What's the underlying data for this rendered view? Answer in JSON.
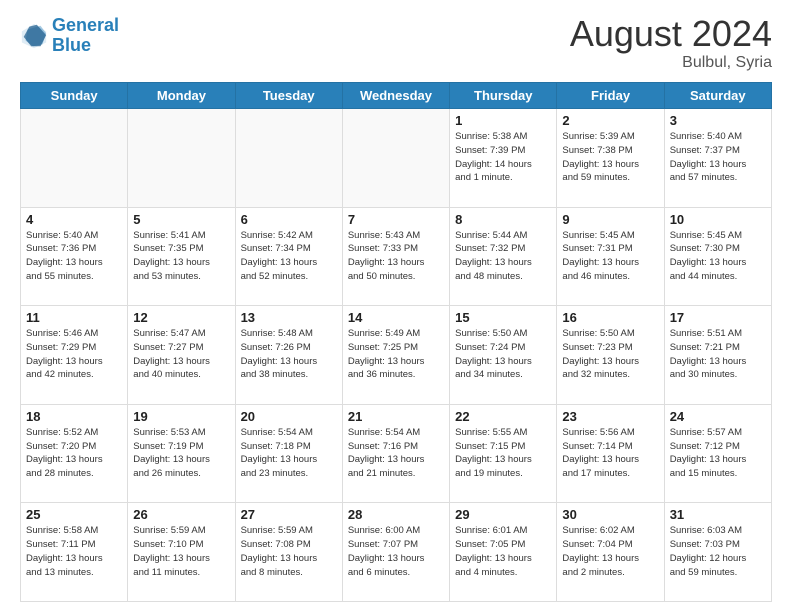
{
  "header": {
    "logo_line1": "General",
    "logo_line2": "Blue",
    "month_year": "August 2024",
    "location": "Bulbul, Syria"
  },
  "days_of_week": [
    "Sunday",
    "Monday",
    "Tuesday",
    "Wednesday",
    "Thursday",
    "Friday",
    "Saturday"
  ],
  "weeks": [
    [
      {
        "day": "",
        "info": "",
        "empty": true
      },
      {
        "day": "",
        "info": "",
        "empty": true
      },
      {
        "day": "",
        "info": "",
        "empty": true
      },
      {
        "day": "",
        "info": "",
        "empty": true
      },
      {
        "day": "1",
        "info": "Sunrise: 5:38 AM\nSunset: 7:39 PM\nDaylight: 14 hours\nand 1 minute."
      },
      {
        "day": "2",
        "info": "Sunrise: 5:39 AM\nSunset: 7:38 PM\nDaylight: 13 hours\nand 59 minutes."
      },
      {
        "day": "3",
        "info": "Sunrise: 5:40 AM\nSunset: 7:37 PM\nDaylight: 13 hours\nand 57 minutes."
      }
    ],
    [
      {
        "day": "4",
        "info": "Sunrise: 5:40 AM\nSunset: 7:36 PM\nDaylight: 13 hours\nand 55 minutes."
      },
      {
        "day": "5",
        "info": "Sunrise: 5:41 AM\nSunset: 7:35 PM\nDaylight: 13 hours\nand 53 minutes."
      },
      {
        "day": "6",
        "info": "Sunrise: 5:42 AM\nSunset: 7:34 PM\nDaylight: 13 hours\nand 52 minutes."
      },
      {
        "day": "7",
        "info": "Sunrise: 5:43 AM\nSunset: 7:33 PM\nDaylight: 13 hours\nand 50 minutes."
      },
      {
        "day": "8",
        "info": "Sunrise: 5:44 AM\nSunset: 7:32 PM\nDaylight: 13 hours\nand 48 minutes."
      },
      {
        "day": "9",
        "info": "Sunrise: 5:45 AM\nSunset: 7:31 PM\nDaylight: 13 hours\nand 46 minutes."
      },
      {
        "day": "10",
        "info": "Sunrise: 5:45 AM\nSunset: 7:30 PM\nDaylight: 13 hours\nand 44 minutes."
      }
    ],
    [
      {
        "day": "11",
        "info": "Sunrise: 5:46 AM\nSunset: 7:29 PM\nDaylight: 13 hours\nand 42 minutes."
      },
      {
        "day": "12",
        "info": "Sunrise: 5:47 AM\nSunset: 7:27 PM\nDaylight: 13 hours\nand 40 minutes."
      },
      {
        "day": "13",
        "info": "Sunrise: 5:48 AM\nSunset: 7:26 PM\nDaylight: 13 hours\nand 38 minutes."
      },
      {
        "day": "14",
        "info": "Sunrise: 5:49 AM\nSunset: 7:25 PM\nDaylight: 13 hours\nand 36 minutes."
      },
      {
        "day": "15",
        "info": "Sunrise: 5:50 AM\nSunset: 7:24 PM\nDaylight: 13 hours\nand 34 minutes."
      },
      {
        "day": "16",
        "info": "Sunrise: 5:50 AM\nSunset: 7:23 PM\nDaylight: 13 hours\nand 32 minutes."
      },
      {
        "day": "17",
        "info": "Sunrise: 5:51 AM\nSunset: 7:21 PM\nDaylight: 13 hours\nand 30 minutes."
      }
    ],
    [
      {
        "day": "18",
        "info": "Sunrise: 5:52 AM\nSunset: 7:20 PM\nDaylight: 13 hours\nand 28 minutes."
      },
      {
        "day": "19",
        "info": "Sunrise: 5:53 AM\nSunset: 7:19 PM\nDaylight: 13 hours\nand 26 minutes."
      },
      {
        "day": "20",
        "info": "Sunrise: 5:54 AM\nSunset: 7:18 PM\nDaylight: 13 hours\nand 23 minutes."
      },
      {
        "day": "21",
        "info": "Sunrise: 5:54 AM\nSunset: 7:16 PM\nDaylight: 13 hours\nand 21 minutes."
      },
      {
        "day": "22",
        "info": "Sunrise: 5:55 AM\nSunset: 7:15 PM\nDaylight: 13 hours\nand 19 minutes."
      },
      {
        "day": "23",
        "info": "Sunrise: 5:56 AM\nSunset: 7:14 PM\nDaylight: 13 hours\nand 17 minutes."
      },
      {
        "day": "24",
        "info": "Sunrise: 5:57 AM\nSunset: 7:12 PM\nDaylight: 13 hours\nand 15 minutes."
      }
    ],
    [
      {
        "day": "25",
        "info": "Sunrise: 5:58 AM\nSunset: 7:11 PM\nDaylight: 13 hours\nand 13 minutes."
      },
      {
        "day": "26",
        "info": "Sunrise: 5:59 AM\nSunset: 7:10 PM\nDaylight: 13 hours\nand 11 minutes."
      },
      {
        "day": "27",
        "info": "Sunrise: 5:59 AM\nSunset: 7:08 PM\nDaylight: 13 hours\nand 8 minutes."
      },
      {
        "day": "28",
        "info": "Sunrise: 6:00 AM\nSunset: 7:07 PM\nDaylight: 13 hours\nand 6 minutes."
      },
      {
        "day": "29",
        "info": "Sunrise: 6:01 AM\nSunset: 7:05 PM\nDaylight: 13 hours\nand 4 minutes."
      },
      {
        "day": "30",
        "info": "Sunrise: 6:02 AM\nSunset: 7:04 PM\nDaylight: 13 hours\nand 2 minutes."
      },
      {
        "day": "31",
        "info": "Sunrise: 6:03 AM\nSunset: 7:03 PM\nDaylight: 12 hours\nand 59 minutes."
      }
    ]
  ]
}
